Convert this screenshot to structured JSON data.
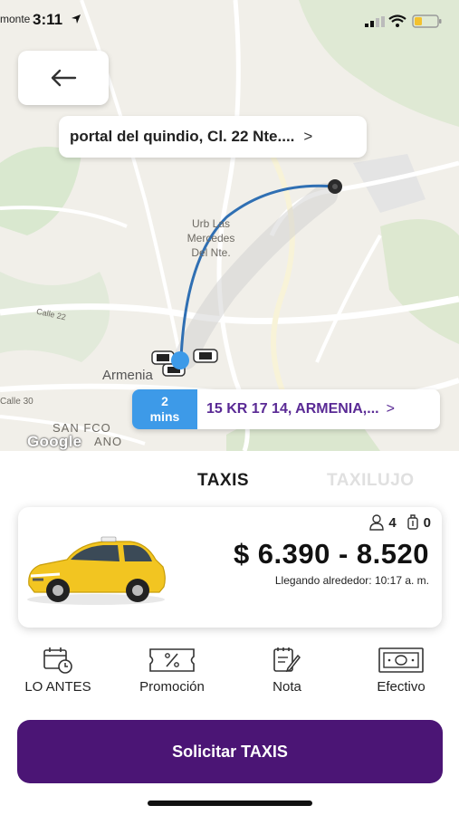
{
  "status_bar": {
    "carrier": "monte",
    "time": "3:11"
  },
  "map": {
    "place_labels": [
      "Urb Las",
      "Mercedes",
      "Del Nte.",
      "Armenia",
      "SAN FCO",
      "ANO",
      "Calle 22",
      "Calle 30"
    ],
    "origin_label": "portal del quindio, Cl. 22 Nte....",
    "eta_value": "2",
    "eta_unit": "mins",
    "destination_label": "15 KR 17 14, ARMENIA,...",
    "chevron": ">",
    "google_logo": "Google"
  },
  "tabs": [
    {
      "label": "TAXIS",
      "active": true
    },
    {
      "label": "TAXILUJO",
      "active": false
    }
  ],
  "vehicle_card": {
    "passengers": "4",
    "luggage": "0",
    "price": "$ 6.390 - 8.520",
    "arrival": "Llegando alrededor: 10:17 a. m."
  },
  "options": [
    {
      "label": "LO ANTES",
      "icon": "calendar-clock-icon"
    },
    {
      "label": "Promoción",
      "icon": "coupon-icon"
    },
    {
      "label": "Nota",
      "icon": "note-icon"
    },
    {
      "label": "Efectivo",
      "icon": "cash-icon"
    }
  ],
  "cta": {
    "label": "Solicitar TAXIS"
  },
  "colors": {
    "brand_purple": "#4b1575",
    "eta_blue": "#3d9ae8",
    "route_blue": "#2f6fb3",
    "destination_text": "#5a2a95"
  }
}
